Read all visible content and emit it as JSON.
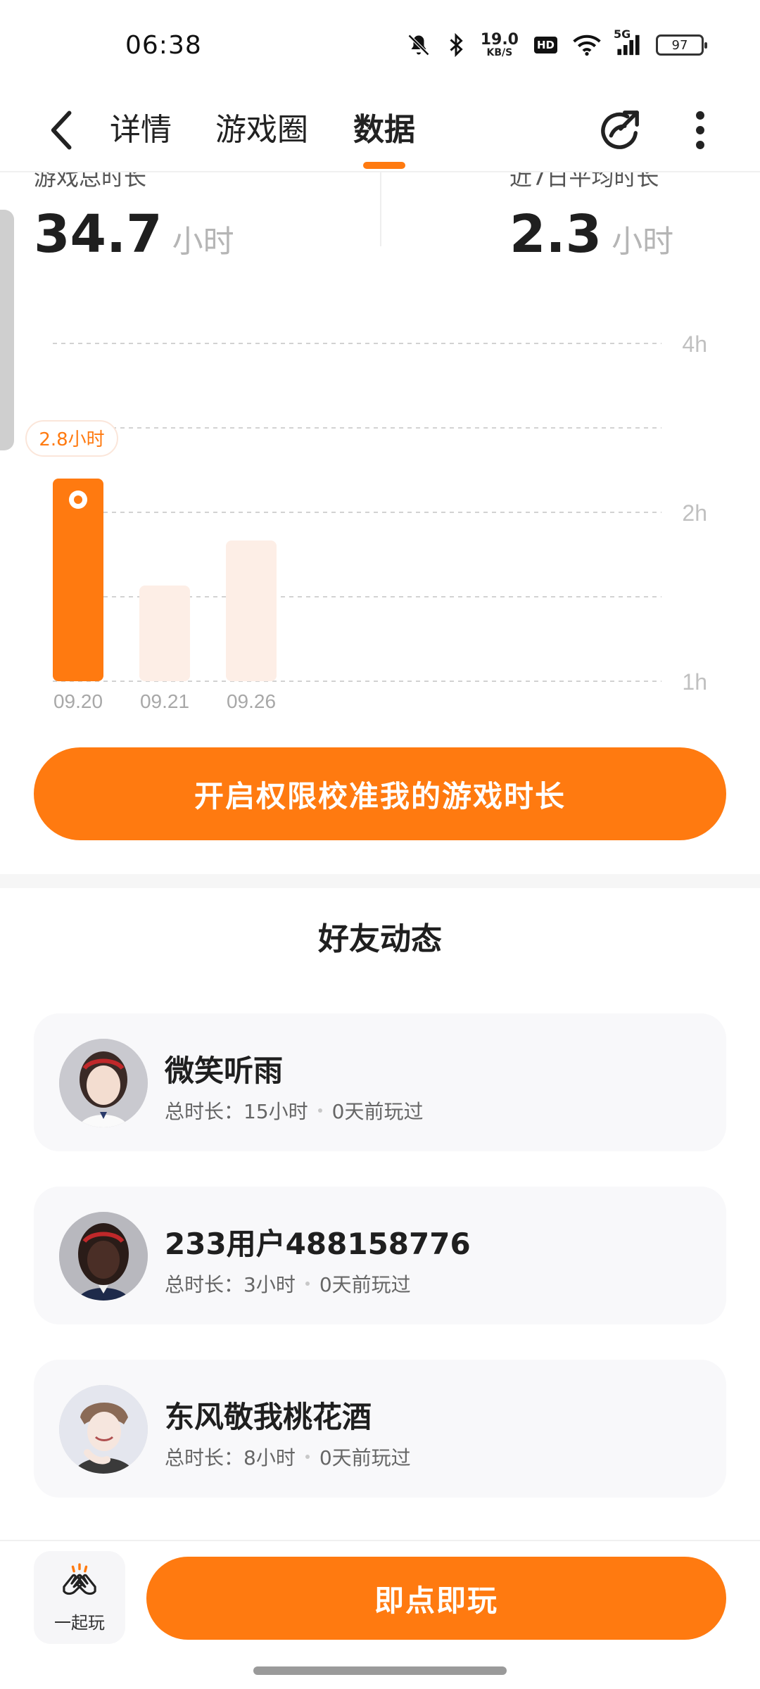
{
  "status_bar": {
    "time": "06:38",
    "net_speed_value": "19.0",
    "net_speed_unit": "KB/S",
    "hd_label": "HD",
    "signal_label": "5G",
    "battery_level": "97",
    "icons": [
      "mute-icon",
      "bluetooth-icon",
      "wifi-icon",
      "cell-signal-icon",
      "battery-icon"
    ]
  },
  "nav": {
    "tabs": [
      {
        "label": "详情",
        "active": false
      },
      {
        "label": "游戏圈",
        "active": false
      },
      {
        "label": "数据",
        "active": true
      }
    ],
    "accent_color": "#ff7a10"
  },
  "stats": {
    "total": {
      "label": "游戏总时长",
      "value": "34.7",
      "unit": "小时"
    },
    "avg": {
      "label": "近7日平均时长",
      "value": "2.3",
      "unit": "小时"
    }
  },
  "chart_data": {
    "type": "bar",
    "categories": [
      "09.20",
      "09.21",
      "09.26"
    ],
    "values": [
      2.8,
      1.85,
      2.25
    ],
    "y_tick_labels": [
      "4h",
      "2h",
      "1h"
    ],
    "highlight_index": 0,
    "highlight_label": "2.8小时",
    "grid": true,
    "colors": {
      "active": "#ff7a10",
      "inactive": "#fdeee6"
    }
  },
  "calibrate_button": {
    "label": "开启权限校准我的游戏时长"
  },
  "friends": {
    "title": "好友动态",
    "items": [
      {
        "name": "微笑听雨",
        "total_label": "总时长：",
        "total": "15小时",
        "last_played": "0天前玩过"
      },
      {
        "name": "233用户488158776",
        "total_label": "总时长：",
        "total": "3小时",
        "last_played": "0天前玩过"
      },
      {
        "name": "东风敬我桃花酒",
        "total_label": "总时长：",
        "total": "8小时",
        "last_played": "0天前玩过"
      }
    ]
  },
  "bottom": {
    "together_label": "一起玩",
    "play_label": "即点即玩"
  }
}
